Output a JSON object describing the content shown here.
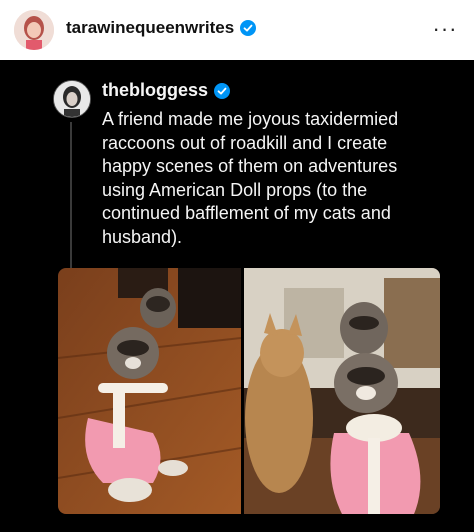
{
  "header": {
    "username": "tarawinequeenwrites",
    "avatar_icon": "profile-photo-icon",
    "verified_icon": "verified-badge-icon",
    "more_icon": "more-options-icon",
    "more_glyph": "···"
  },
  "post": {
    "username": "thebloggess",
    "avatar_icon": "profile-photo-icon",
    "verified_icon": "verified-badge-icon",
    "text": "A friend made me joyous taxidermied raccoons out of roadkill and I create happy scenes of them on adventures using American Doll props (to the continued bafflement of my cats and husband).",
    "images": [
      {
        "name": "raccoons-on-pink-scooter-photo",
        "icon": "photo-icon"
      },
      {
        "name": "raccoons-scooter-with-cat-photo",
        "icon": "photo-icon"
      }
    ]
  },
  "colors": {
    "verified_blue": "#0095f6",
    "dark_bg": "#000000",
    "text_light": "#f5f5f5",
    "scooter_pink": "#f29ab0"
  }
}
